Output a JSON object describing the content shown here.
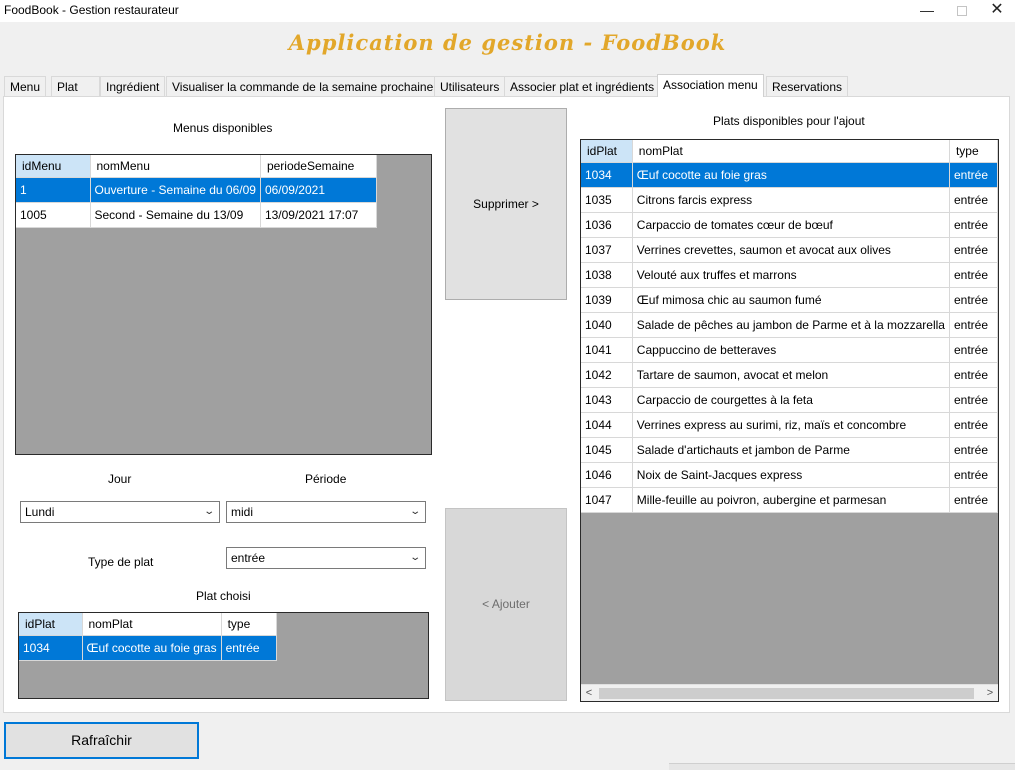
{
  "window": {
    "title": "FoodBook - Gestion restaurateur",
    "minimize": "—",
    "close": "✕"
  },
  "header": {
    "title": "Application de gestion - FoodBook"
  },
  "tabs": [
    {
      "label": "Menu"
    },
    {
      "label": "Plat"
    },
    {
      "label": "Ingrédient"
    },
    {
      "label": "Visualiser la commande de la semaine prochaine"
    },
    {
      "label": "Utilisateurs"
    },
    {
      "label": "Associer plat et ingrédients"
    },
    {
      "label": "Association menu"
    },
    {
      "label": "Reservations"
    }
  ],
  "active_tab": "Association menu",
  "menus": {
    "title": "Menus disponibles",
    "columns": [
      "idMenu",
      "nomMenu",
      "periodeSemaine"
    ],
    "rows": [
      {
        "id": "1",
        "nom": "Ouverture - Semaine du 06/09",
        "periode": "06/09/2021"
      },
      {
        "id": "1005",
        "nom": "Second  - Semaine du 13/09",
        "periode": "13/09/2021 17:07"
      }
    ]
  },
  "form": {
    "jour_label": "Jour",
    "periode_label": "Période",
    "jour_value": "Lundi",
    "periode_value": "midi",
    "type_label": "Type de plat",
    "type_value": "entrée"
  },
  "plat_choisi": {
    "title": "Plat choisi",
    "columns": [
      "idPlat",
      "nomPlat",
      "type"
    ],
    "rows": [
      {
        "id": "1034",
        "nom": "Œuf cocotte au foie gras",
        "type": "entrée"
      }
    ]
  },
  "buttons": {
    "supprimer": "Supprimer >",
    "ajouter": "< Ajouter",
    "rafraichir": "Rafraîchir"
  },
  "plats": {
    "title": "Plats disponibles pour l'ajout",
    "columns": [
      "idPlat",
      "nomPlat",
      "type"
    ],
    "rows": [
      {
        "id": "1034",
        "nom": "Œuf cocotte au foie gras",
        "type": "entrée"
      },
      {
        "id": "1035",
        "nom": "Citrons farcis express",
        "type": "entrée"
      },
      {
        "id": "1036",
        "nom": "Carpaccio de tomates cœur de bœuf",
        "type": "entrée"
      },
      {
        "id": "1037",
        "nom": "Verrines crevettes, saumon et avocat aux olives",
        "type": "entrée"
      },
      {
        "id": "1038",
        "nom": "Velouté aux truffes et marrons",
        "type": "entrée"
      },
      {
        "id": "1039",
        "nom": "Œuf mimosa chic au saumon fumé",
        "type": "entrée"
      },
      {
        "id": "1040",
        "nom": "Salade de pêches au jambon de Parme et à la mozzarella",
        "type": "entrée"
      },
      {
        "id": "1041",
        "nom": "Cappuccino de betteraves",
        "type": "entrée"
      },
      {
        "id": "1042",
        "nom": "Tartare de saumon, avocat et melon",
        "type": "entrée"
      },
      {
        "id": "1043",
        "nom": "Carpaccio de courgettes à la feta",
        "type": "entrée"
      },
      {
        "id": "1044",
        "nom": "Verrines express au surimi, riz, maïs et concombre",
        "type": "entrée"
      },
      {
        "id": "1045",
        "nom": "Salade d'artichauts et jambon de Parme",
        "type": "entrée"
      },
      {
        "id": "1046",
        "nom": "Noix de Saint-Jacques express",
        "type": "entrée"
      },
      {
        "id": "1047",
        "nom": "Mille-feuille au poivron, aubergine et parmesan",
        "type": "entrée"
      }
    ]
  },
  "icons": {
    "dropdown": "chevron-down-icon",
    "scroll_left": "chevron-left-icon",
    "scroll_right": "chevron-right-icon"
  },
  "colors": {
    "accent": "#0078d7",
    "title": "#e2a72a",
    "grid_bg": "#a0a0a0",
    "header_sorted": "#cce4f7"
  }
}
